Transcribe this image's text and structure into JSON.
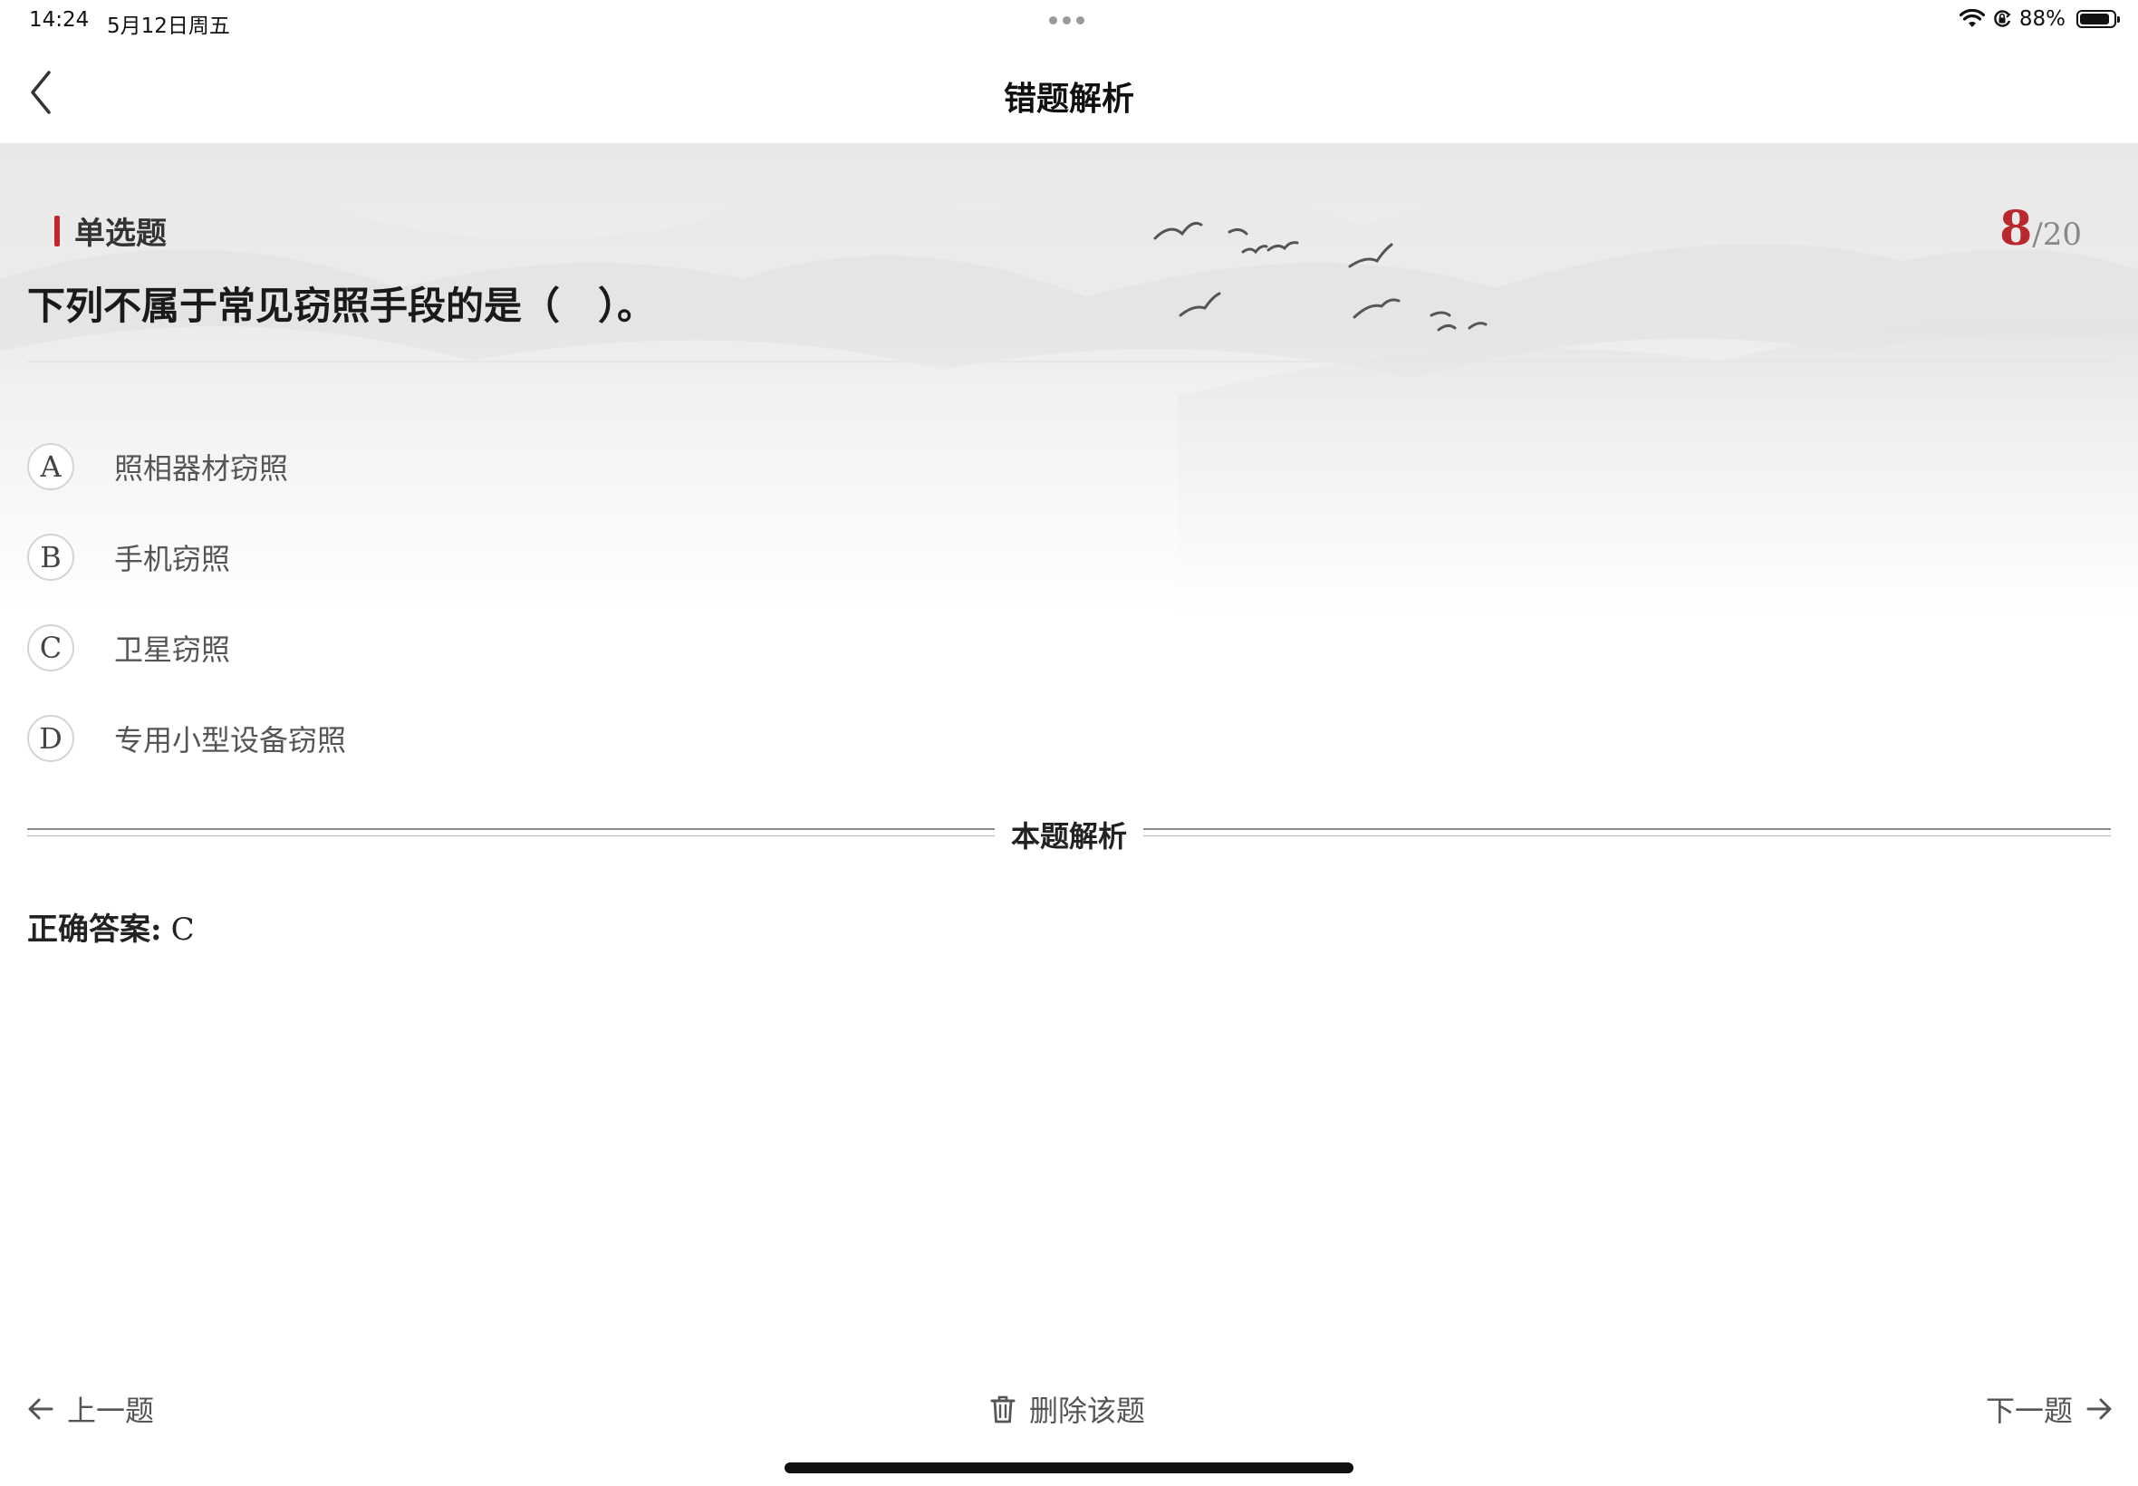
{
  "status_bar": {
    "time": "14:24",
    "date": "5月12日周五",
    "battery_percent": "88%",
    "battery_level": 0.88
  },
  "nav": {
    "title": "错题解析"
  },
  "question": {
    "type_label": "单选题",
    "current_index": "8",
    "total": "/20",
    "text": "下列不属于常见窃照手段的是（　）。",
    "options": [
      {
        "letter": "A",
        "text": "照相器材窃照"
      },
      {
        "letter": "B",
        "text": "手机窃照"
      },
      {
        "letter": "C",
        "text": "卫星窃照"
      },
      {
        "letter": "D",
        "text": "专用小型设备窃照"
      }
    ]
  },
  "analysis": {
    "title": "本题解析",
    "answer_label": "正确答案:",
    "answer_value": "C"
  },
  "bottom": {
    "prev_label": "上一题",
    "delete_label": "删除该题",
    "next_label": "下一题"
  },
  "colors": {
    "accent": "#b8282d",
    "text": "#222222",
    "muted": "#555555"
  }
}
